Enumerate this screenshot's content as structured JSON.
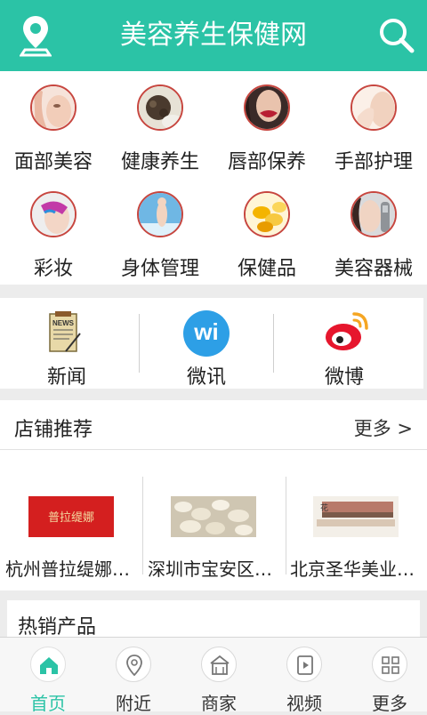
{
  "header": {
    "title": "美容养生保健网",
    "location_icon": "location-pin-icon",
    "search_icon": "search-icon"
  },
  "categories": [
    {
      "label": "面部美容",
      "icon": "face-beauty-icon"
    },
    {
      "label": "健康养生",
      "icon": "health-icon"
    },
    {
      "label": "唇部保养",
      "icon": "lips-icon"
    },
    {
      "label": "手部护理",
      "icon": "hand-care-icon"
    },
    {
      "label": "彩妆",
      "icon": "makeup-icon"
    },
    {
      "label": "身体管理",
      "icon": "body-icon"
    },
    {
      "label": "保健品",
      "icon": "supplement-icon"
    },
    {
      "label": "美容器械",
      "icon": "device-icon"
    }
  ],
  "quick": [
    {
      "label": "新闻",
      "icon": "news-icon"
    },
    {
      "label": "微讯",
      "icon": "weixun-icon",
      "badge": "wi"
    },
    {
      "label": "微博",
      "icon": "weibo-icon"
    }
  ],
  "shops": {
    "title": "店铺推荐",
    "more": "更多 >",
    "items": [
      {
        "name": "杭州普拉缇娜…",
        "logo_text": "普拉缇娜"
      },
      {
        "name": "深圳市宝安区…"
      },
      {
        "name": "北京圣华美业…"
      }
    ]
  },
  "hot": {
    "title": "热销产品"
  },
  "tabs": [
    {
      "label": "首页",
      "icon": "home-icon",
      "active": true
    },
    {
      "label": "附近",
      "icon": "nearby-pin-icon"
    },
    {
      "label": "商家",
      "icon": "store-icon"
    },
    {
      "label": "视频",
      "icon": "video-icon"
    },
    {
      "label": "更多",
      "icon": "grid-icon"
    }
  ],
  "colors": {
    "accent": "#2bc3a6",
    "icon_border": "#c7463f",
    "weibo": "#e6162d",
    "weixun": "#2d9fe6"
  }
}
